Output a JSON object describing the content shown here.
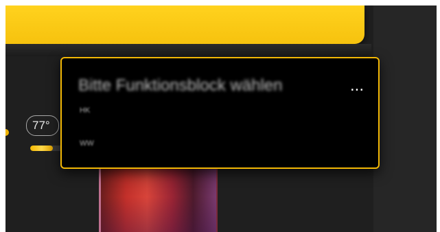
{
  "temperature": {
    "value": "77",
    "unit": "°"
  },
  "progress": {
    "fraction": 0.25
  },
  "popup": {
    "title": "Bitte Funktionsblock wählen",
    "ellipsis": "...",
    "options": [
      {
        "label": "HK"
      },
      {
        "label": "WW"
      }
    ]
  },
  "colors": {
    "accent": "#f2b705",
    "banner": "#ffd21e",
    "background": "#1f1f1f",
    "popup_bg": "#000000"
  }
}
